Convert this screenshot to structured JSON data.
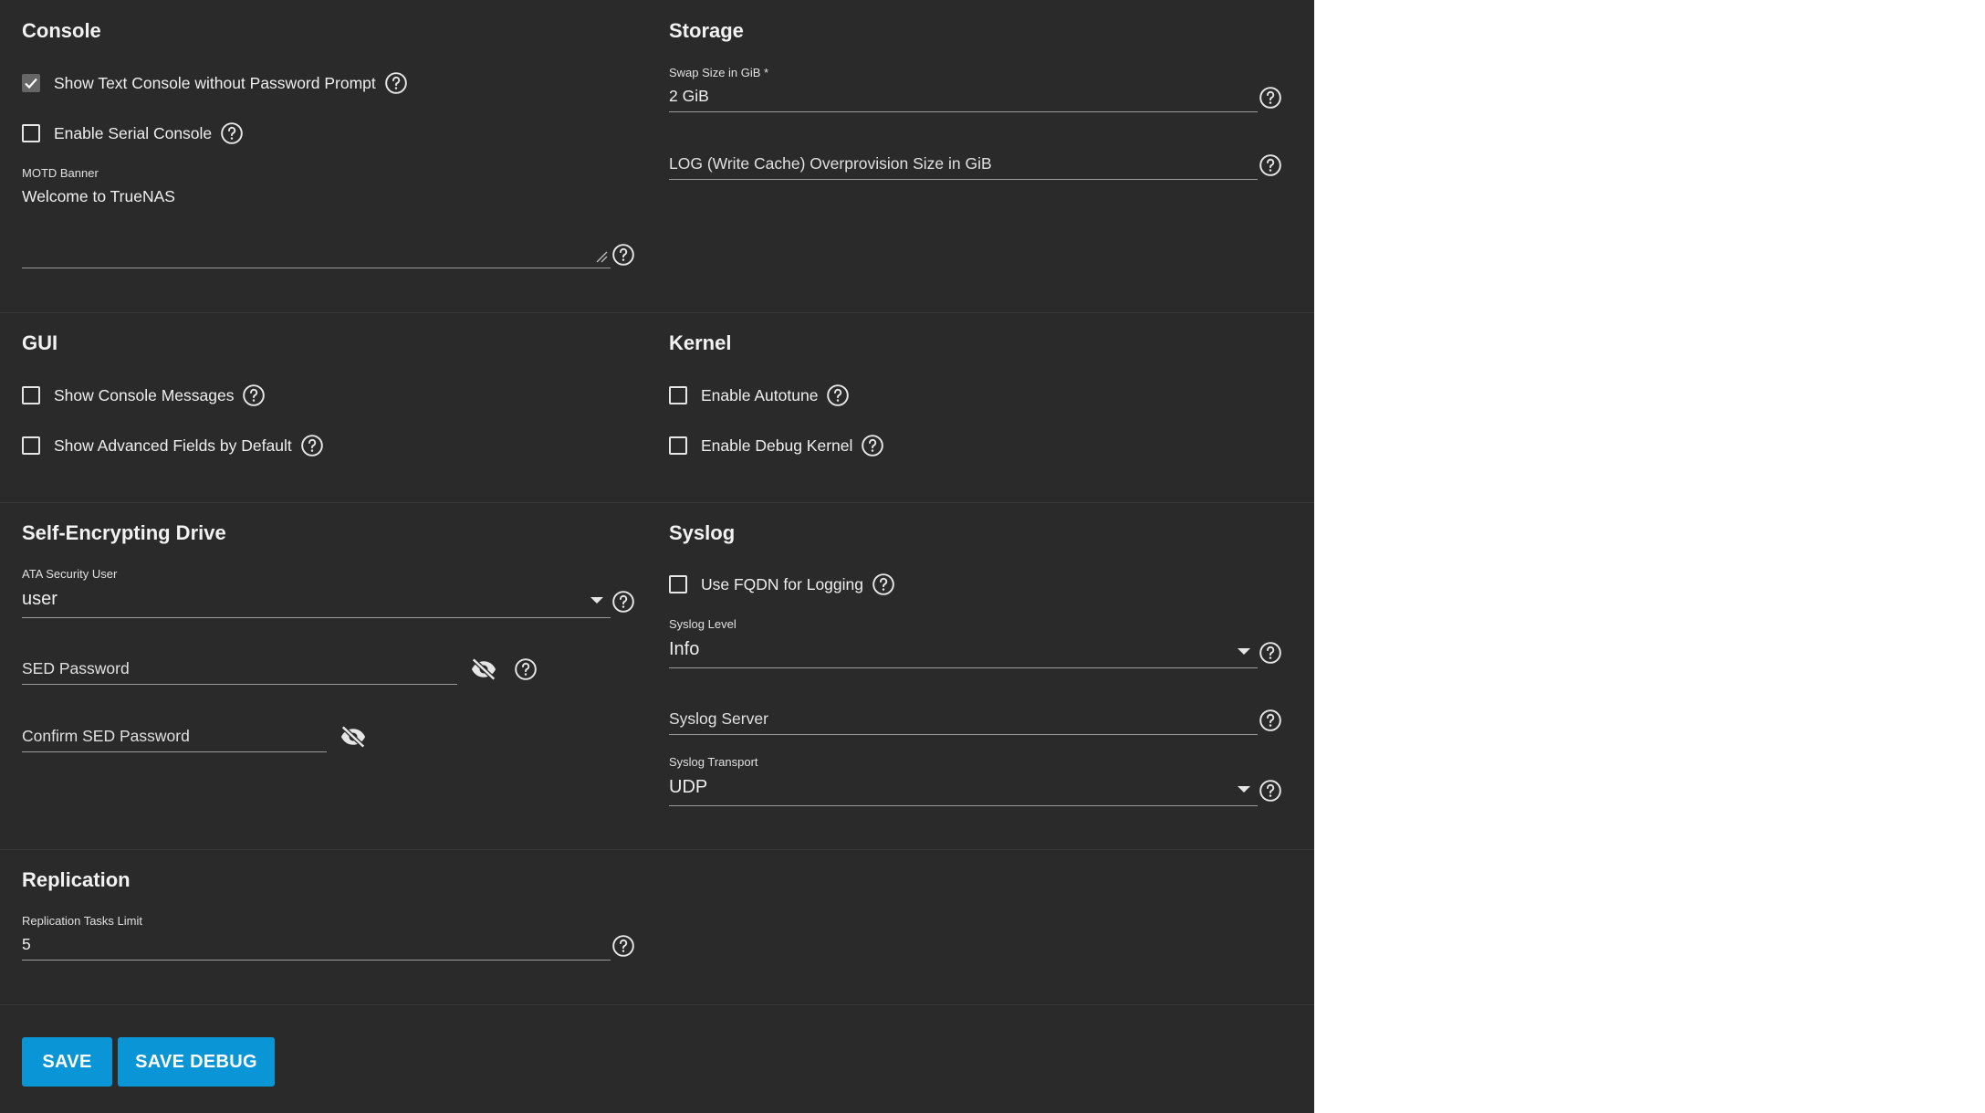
{
  "console": {
    "title": "Console",
    "show_text_console_label": "Show Text Console without Password Prompt",
    "enable_serial_console_label": "Enable Serial Console",
    "motd_label": "MOTD Banner",
    "motd_value": "Welcome to TrueNAS"
  },
  "storage": {
    "title": "Storage",
    "swap_label": "Swap Size in GiB *",
    "swap_value": "2 GiB",
    "log_placeholder": "LOG (Write Cache) Overprovision Size in GiB"
  },
  "gui": {
    "title": "GUI",
    "show_console_messages_label": "Show Console Messages",
    "show_advanced_fields_label": "Show Advanced Fields by Default"
  },
  "kernel": {
    "title": "Kernel",
    "enable_autotune_label": "Enable Autotune",
    "enable_debug_kernel_label": "Enable Debug Kernel"
  },
  "sed": {
    "title": "Self-Encrypting Drive",
    "ata_user_label": "ATA Security User",
    "ata_user_value": "user",
    "password_placeholder": "SED Password",
    "confirm_password_placeholder": "Confirm SED Password"
  },
  "syslog": {
    "title": "Syslog",
    "fqdn_label": "Use FQDN for Logging",
    "level_label": "Syslog Level",
    "level_value": "Info",
    "server_placeholder": "Syslog Server",
    "transport_label": "Syslog Transport",
    "transport_value": "UDP"
  },
  "replication": {
    "title": "Replication",
    "tasks_limit_label": "Replication Tasks Limit",
    "tasks_limit_value": "5"
  },
  "actions": {
    "save_label": "SAVE",
    "save_debug_label": "SAVE DEBUG"
  },
  "colors": {
    "panel_bg": "#2a2a2a",
    "button_primary": "#0a95d6",
    "page_bg": "#ffffff"
  },
  "icons": [
    "help-icon",
    "checkmark-icon",
    "eye-off-icon",
    "dropdown-caret-icon",
    "resize-handle-icon"
  ]
}
